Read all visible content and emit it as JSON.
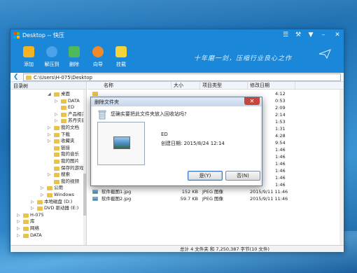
{
  "window": {
    "title": "Desktop -- 快压",
    "slogan": "十年磨一剑，压缩行业良心之作",
    "address": "C:\\Users\\H-075\\Desktop"
  },
  "toolbar": [
    {
      "label": "添加",
      "icon": "add-icon",
      "color": "#f5b324"
    },
    {
      "label": "解压到",
      "icon": "extract-icon",
      "color": "#4aa3e8"
    },
    {
      "label": "删除",
      "icon": "delete-icon",
      "color": "#4fb85a"
    },
    {
      "label": "向导",
      "icon": "wizard-icon",
      "color": "#f08a2a"
    },
    {
      "label": "挂载",
      "icon": "mount-icon",
      "color": "#f3d43a"
    }
  ],
  "tree": {
    "header": "目录树",
    "items": [
      {
        "label": "桌面",
        "level": 1,
        "exp": "◢"
      },
      {
        "label": "DATA",
        "level": 2,
        "exp": "▷"
      },
      {
        "label": "ED",
        "level": 2,
        "exp": ""
      },
      {
        "label": "产品相关",
        "level": 2,
        "exp": "▷"
      },
      {
        "label": "苏丹实验",
        "level": 2,
        "exp": "▷"
      },
      {
        "label": "我的文档",
        "level": 1,
        "exp": "▷"
      },
      {
        "label": "下载",
        "level": 1,
        "exp": "▷"
      },
      {
        "label": "收藏夹",
        "level": 1,
        "exp": "▷"
      },
      {
        "label": "链接",
        "level": 1,
        "exp": ""
      },
      {
        "label": "我的音乐",
        "level": 1,
        "exp": ""
      },
      {
        "label": "我的图片",
        "level": 1,
        "exp": ""
      },
      {
        "label": "保存的游戏",
        "level": 1,
        "exp": ""
      },
      {
        "label": "搜索",
        "level": 1,
        "exp": "▷"
      },
      {
        "label": "我的视频",
        "level": 1,
        "exp": ""
      },
      {
        "label": "公用",
        "level": 0,
        "exp": "▷"
      },
      {
        "label": "Windows",
        "level": 0,
        "exp": "▷"
      },
      {
        "label": "本地磁盘 (D:)",
        "level": -1,
        "exp": "▷"
      },
      {
        "label": "DVD 驱动器 (E:)",
        "level": -1,
        "exp": "▷"
      },
      {
        "label": "H-075",
        "level": -2,
        "exp": "▷"
      },
      {
        "label": "库",
        "level": -2,
        "exp": "▷"
      },
      {
        "label": "网络",
        "level": -2,
        "exp": "▷"
      },
      {
        "label": "DATA",
        "level": -2,
        "exp": "▷"
      }
    ]
  },
  "list": {
    "columns": [
      "名称",
      "大小",
      "项目类型",
      "修改日期"
    ],
    "rows": [
      {
        "name": "",
        "size": "",
        "type": "",
        "date": "4:12"
      },
      {
        "name": "",
        "size": "",
        "type": "",
        "date": "0:53"
      },
      {
        "name": "",
        "size": "",
        "type": "",
        "date": "2:09"
      },
      {
        "name": "",
        "size": "",
        "type": "",
        "date": "2:14"
      },
      {
        "name": "",
        "size": "",
        "type": "",
        "date": "1:53"
      },
      {
        "name": "",
        "size": "",
        "type": "",
        "date": "1:31"
      },
      {
        "name": "",
        "size": "",
        "type": "",
        "date": "4:28"
      },
      {
        "name": "",
        "size": "",
        "type": "",
        "date": "9:54"
      },
      {
        "name": "",
        "size": "",
        "type": "",
        "date": "1:46"
      },
      {
        "name": "",
        "size": "",
        "type": "",
        "date": "1:46"
      },
      {
        "name": "",
        "size": "",
        "type": "",
        "date": "1:46"
      },
      {
        "name": "",
        "size": "",
        "type": "",
        "date": "1:46"
      },
      {
        "name": "",
        "size": "",
        "type": "",
        "date": "1:46"
      },
      {
        "name": "",
        "size": "",
        "type": "",
        "date": "1:46"
      },
      {
        "name": "软件截图1.jpg",
        "size": "152 KB",
        "type": "JPEG 图像",
        "date": "2015/9/11 11:46"
      },
      {
        "name": "软件截图2.jpg",
        "size": "59.7 KB",
        "type": "JPEG 图像",
        "date": "2015/9/11 11:46"
      }
    ]
  },
  "status": "总计 4 文件夹 和 7,250,387 字节(10 文件)",
  "dialog": {
    "title": "删除文件夹",
    "question": "您确实要把此文件夹放入回收站吗?",
    "file_name": "ED",
    "created": "创建日期: 2015/8/24 12:14",
    "yes_label": "是(Y)",
    "no_label": "否(N)"
  }
}
